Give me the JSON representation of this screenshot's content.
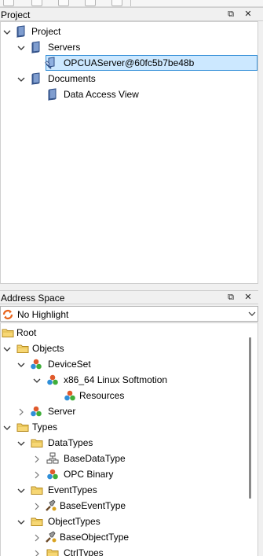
{
  "project_panel": {
    "title": "Project",
    "buttons": [
      {
        "name": "float",
        "glyph": "⧉"
      },
      {
        "name": "close",
        "glyph": "✕"
      }
    ],
    "tree": [
      {
        "label": "Project",
        "icon": "project-book-icon",
        "expander": "expanded"
      },
      {
        "label": "Servers",
        "icon": "project-book-icon",
        "expander": "expanded"
      },
      {
        "label": "OPCUAServer@60fc5b7be48b",
        "icon": "server-connection-icon",
        "expander": "none",
        "selected": true
      },
      {
        "label": "Documents",
        "icon": "project-book-icon",
        "expander": "expanded"
      },
      {
        "label": "Data Access View",
        "icon": "project-book-icon",
        "expander": "none"
      }
    ]
  },
  "address_panel": {
    "title": "Address Space",
    "buttons": [
      {
        "name": "float",
        "glyph": "⧉"
      },
      {
        "name": "close",
        "glyph": "✕"
      }
    ],
    "filter": {
      "value": "No Highlight",
      "icon": "refresh-icon"
    },
    "tree": [
      {
        "label": "Root",
        "icon": "folder-icon",
        "expander": "none"
      },
      {
        "label": "Objects",
        "icon": "folder-icon",
        "expander": "expanded"
      },
      {
        "label": "DeviceSet",
        "icon": "object-node-icon",
        "expander": "expanded"
      },
      {
        "label": "x86_64 Linux Softmotion",
        "icon": "object-node-icon",
        "expander": "expanded"
      },
      {
        "label": "Resources",
        "icon": "object-node-icon",
        "expander": "none"
      },
      {
        "label": "Server",
        "icon": "object-node-icon",
        "expander": "collapsed"
      },
      {
        "label": "Types",
        "icon": "folder-icon",
        "expander": "expanded"
      },
      {
        "label": "DataTypes",
        "icon": "folder-icon",
        "expander": "expanded"
      },
      {
        "label": "BaseDataType",
        "icon": "datatype-icon",
        "expander": "collapsed"
      },
      {
        "label": "OPC Binary",
        "icon": "object-node-icon",
        "expander": "collapsed"
      },
      {
        "label": "EventTypes",
        "icon": "folder-icon",
        "expander": "expanded"
      },
      {
        "label": "BaseEventType",
        "icon": "event-type-icon",
        "expander": "collapsed"
      },
      {
        "label": "ObjectTypes",
        "icon": "folder-icon",
        "expander": "expanded"
      },
      {
        "label": "BaseObjectType",
        "icon": "event-type-icon",
        "expander": "collapsed"
      },
      {
        "label": "CtrlTypes",
        "icon": "folder-icon",
        "expander": "collapsed"
      }
    ]
  },
  "colors": {
    "selection_bg": "#cce8ff",
    "selection_border": "#3b93d9",
    "folder": "#f5d66a",
    "book": "#5b7fb5"
  }
}
